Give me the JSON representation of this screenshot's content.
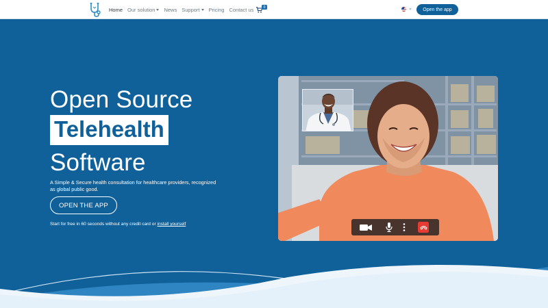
{
  "nav": {
    "logo_icon": "stethoscope-logo-icon",
    "links": [
      {
        "label": "Home",
        "active": true,
        "dropdown": false
      },
      {
        "label": "Our solution",
        "active": false,
        "dropdown": true
      },
      {
        "label": "News",
        "active": false,
        "dropdown": false
      },
      {
        "label": "Support",
        "active": false,
        "dropdown": true
      },
      {
        "label": "Pricing",
        "active": false,
        "dropdown": false
      },
      {
        "label": "Contact us",
        "active": false,
        "dropdown": false
      }
    ],
    "cart_icon": "cart-icon",
    "cart_count": "0",
    "language_icon": "us-flag-icon",
    "open_app_label": "Open the app"
  },
  "hero": {
    "title_line1": "Open Source",
    "title_highlight": "Telehealth",
    "title_line3": "Software",
    "subtitle": "A Simple & Secure health consultation for healthcare providers, recognized as global public good.",
    "cta_label": "OPEN THE APP",
    "note_prefix": "Start for free in 60 seconds without any credit card or ",
    "note_link": "install yourself"
  },
  "video_call": {
    "main_image": "smiling-woman-patient-image",
    "pip_image": "doctor-with-stethoscope-image",
    "controls": [
      "camera-icon",
      "microphone-icon",
      "more-vertical-icon",
      "hang-up-icon"
    ]
  },
  "colors": {
    "brand_blue": "#10619a",
    "hang_up_red": "#e63b32",
    "white": "#ffffff"
  }
}
